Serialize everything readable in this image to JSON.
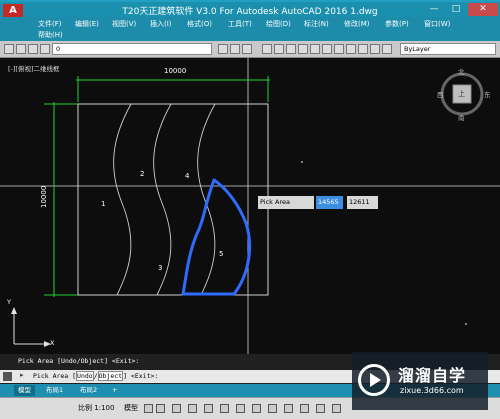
{
  "titlebar": {
    "app_logo": "A",
    "title": "T20天正建筑软件 V3.0 For Autodesk AutoCAD 2016    1.dwg",
    "minimize": "—",
    "maximize": "□",
    "close": "✕"
  },
  "menu": {
    "row1": [
      "文件(F)",
      "编辑(E)",
      "视图(V)",
      "插入(I)",
      "格式(O)",
      "工具(T)",
      "绘图(D)",
      "标注(N)",
      "修改(M)",
      "参数(P)",
      "窗口(W)"
    ],
    "row2": [
      "帮助(H)"
    ]
  },
  "toolbar": {
    "layer_value": "0",
    "linetype_value": "ByLayer"
  },
  "canvas": {
    "view_label": "[-][俯视]二维线框",
    "dim_horizontal": "10000",
    "dim_vertical": "10000",
    "regions": [
      "1",
      "2",
      "3",
      "4",
      "5"
    ],
    "compass": {
      "north": "北",
      "south": "南",
      "west": "西",
      "east": "东",
      "center": "上"
    },
    "ucs": {
      "y": "Y",
      "x": "X"
    },
    "pick_area": {
      "label": "Pick Area",
      "value1": "14565",
      "value2": "12611"
    }
  },
  "command": {
    "history": "Pick Area [Undo/Object] <Exit>:",
    "prompt_prefix": "Pick Area [",
    "undo": "Undo",
    "sep": "/",
    "object": "Object",
    "prompt_suffix": "] <Exit>:"
  },
  "tabs": {
    "model": "模型",
    "layout1": "布局1",
    "layout2": "布局2",
    "add": "+"
  },
  "status": {
    "scale": "比例 1:100",
    "model": "模型"
  },
  "watermark": {
    "name": "溜溜自学",
    "url": "zixue.3d66.com"
  },
  "colors": {
    "title_blue": "#1b8fae",
    "boundary_blue": "#2f6bff",
    "dim_green": "#1fd12f"
  }
}
